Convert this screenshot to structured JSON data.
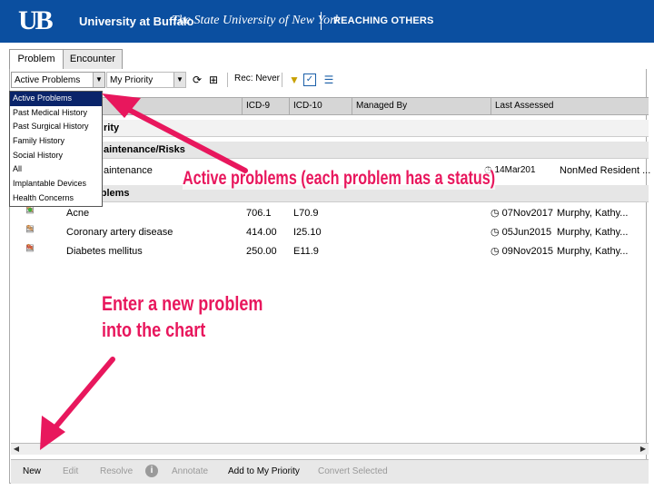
{
  "banner": {
    "logo": "UB",
    "university": "University at Buffalo",
    "subtitle": "The State University of New York",
    "tagline": "REACHING OTHERS"
  },
  "tabs": [
    {
      "label": "Problem",
      "active": true
    },
    {
      "label": "Encounter",
      "active": false
    }
  ],
  "toolbar": {
    "filter_value": "Active Problems",
    "priority_value": "My Priority",
    "rec_label": "Rec: Never"
  },
  "dropdown": {
    "options": [
      "Active Problems",
      "Past Medical History",
      "Past Surgical History",
      "Family History",
      "Social History",
      "All",
      "Implantable Devices",
      "Health Concerns"
    ],
    "selected": "Active Problems"
  },
  "grid": {
    "columns": [
      "ICD-9",
      "ICD-10",
      "Managed By",
      "Last Assessed"
    ],
    "groups": [
      {
        "label": "rity"
      },
      {
        "label": "aintenance/Risks"
      }
    ],
    "maintenance_row": {
      "name": "aintenance",
      "last_assessed": "14Mar201",
      "by": "NonMed  Resident ..."
    },
    "groups2": {
      "label": "oblems"
    },
    "rows": [
      {
        "name": "Acne",
        "icd9": "706.1",
        "icd10": "L70.9",
        "last_assessed": "07Nov2017",
        "by": "Murphy,  Kathy..."
      },
      {
        "name": "Coronary artery disease",
        "icd9": "414.00",
        "icd10": "I25.10",
        "last_assessed": "05Jun2015",
        "by": "Murphy,  Kathy..."
      },
      {
        "name": "Diabetes mellitus",
        "icd9": "250.00",
        "icd10": "E11.9",
        "last_assessed": "09Nov2015",
        "by": "Murphy,  Kathy..."
      }
    ]
  },
  "bottombar": {
    "new": "New",
    "edit": "Edit",
    "resolve": "Resolve",
    "annotate": "Annotate",
    "add_priority": "Add to My Priority",
    "convert": "Convert Selected"
  },
  "callouts": {
    "active_problems": "Active problems (each problem has a status)",
    "enter_line1": "Enter a new problem",
    "enter_line2": "into the chart"
  },
  "colors": {
    "banner": "#0b4fa0",
    "callout": "#e8175d",
    "dropdown_selection": "#0a246a"
  }
}
